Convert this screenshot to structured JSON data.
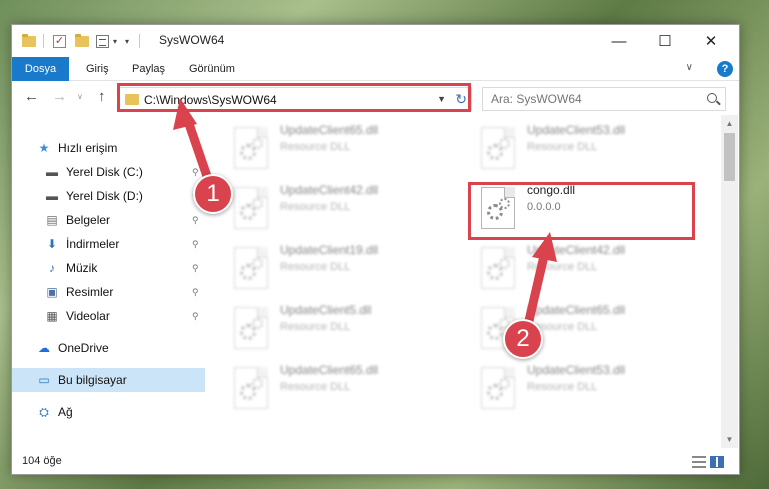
{
  "window": {
    "title": "SysWOW64",
    "minimize_glyph": "—",
    "maximize_glyph": "☐",
    "close_glyph": "✕"
  },
  "ribbon": {
    "tabs": [
      "Dosya",
      "Giriş",
      "Paylaş",
      "Görünüm"
    ],
    "expand_glyph": "∨",
    "help_glyph": "?"
  },
  "nav": {
    "back_glyph": "←",
    "forward_glyph": "→",
    "recent_glyph": "∨",
    "up_glyph": "↑",
    "address": "C:\\Windows\\SysWOW64",
    "search_placeholder": "Ara: SysWOW64"
  },
  "sidebar": {
    "items": [
      {
        "label": "Hızlı erişim",
        "icon": "star-icon",
        "glyph": "★",
        "color": "#3c8fd8",
        "pinned": false
      },
      {
        "label": "Yerel Disk (C:)",
        "icon": "drive-icon",
        "glyph": "▬",
        "color": "#555555",
        "pinned": true
      },
      {
        "label": "Yerel Disk (D:)",
        "icon": "drive-icon",
        "glyph": "▬",
        "color": "#555555",
        "pinned": true
      },
      {
        "label": "Belgeler",
        "icon": "documents-icon",
        "glyph": "▤",
        "color": "#6d6d6d",
        "pinned": true
      },
      {
        "label": "İndirmeler",
        "icon": "download-icon",
        "glyph": "⬇",
        "color": "#2f74c0",
        "pinned": true
      },
      {
        "label": "Müzik",
        "icon": "music-icon",
        "glyph": "♪",
        "color": "#2f74c0",
        "pinned": true
      },
      {
        "label": "Resimler",
        "icon": "pictures-icon",
        "glyph": "▣",
        "color": "#4f6f9f",
        "pinned": true
      },
      {
        "label": "Videolar",
        "icon": "video-icon",
        "glyph": "▦",
        "color": "#555555",
        "pinned": true
      },
      {
        "label": "OneDrive",
        "icon": "cloud-icon",
        "glyph": "☁",
        "color": "#1e6fd9",
        "pinned": false
      },
      {
        "label": "Bu bilgisayar",
        "icon": "computer-icon",
        "glyph": "▭",
        "color": "#2f74c0",
        "pinned": false,
        "selected": true
      },
      {
        "label": "Ağ",
        "icon": "network-icon",
        "glyph": "⛭",
        "color": "#2f74c0",
        "pinned": false
      }
    ],
    "pin_glyph": "📌"
  },
  "files": {
    "left_column": [
      {
        "name": "UpdateClient65.dll",
        "desc": "Resource DLL"
      },
      {
        "name": "UpdateClient42.dll",
        "desc": "Resource DLL"
      },
      {
        "name": "UpdateClient19.dll",
        "desc": "Resource DLL"
      },
      {
        "name": "UpdateClient5.dll",
        "desc": "Resource DLL"
      },
      {
        "name": "UpdateClient65.dll",
        "desc": "Resource DLL"
      }
    ],
    "right_column": [
      {
        "name": "UpdateClient53.dll",
        "desc": "Resource DLL"
      },
      {
        "name": "congo.dll",
        "desc": "0.0.0.0",
        "highlighted": true
      },
      {
        "name": "UpdateClient42.dll",
        "desc": "Resource DLL"
      },
      {
        "name": "UpdateClient65.dll",
        "desc": "Resource DLL"
      },
      {
        "name": "UpdateClient53.dll",
        "desc": "Resource DLL"
      }
    ]
  },
  "status": {
    "item_count": "104 öğe"
  },
  "annotations": {
    "markers": [
      "1",
      "2"
    ],
    "color": "#d9434e"
  },
  "colors": {
    "accent": "#1979ca",
    "selection": "#cce4f7",
    "annotation": "#d9434e"
  }
}
